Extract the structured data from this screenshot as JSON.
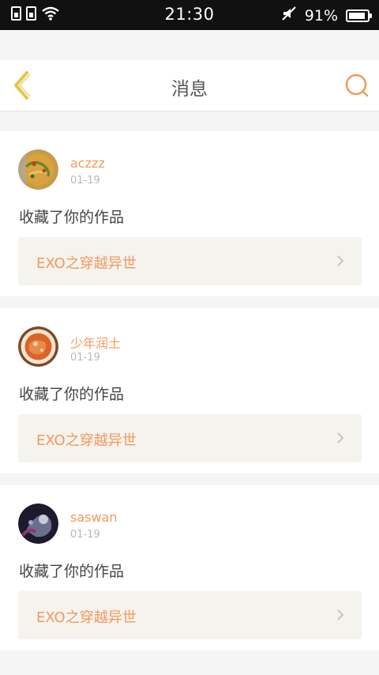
{
  "status_bar": {
    "time": "21:30",
    "battery_text": "91%",
    "battery_level": 0.91,
    "icons": [
      "sim-card-icon",
      "sim-card-icon",
      "wifi-icon",
      "mute-icon",
      "battery-icon"
    ]
  },
  "header": {
    "title": "消息",
    "back_icon": "chevron-left-icon",
    "search_icon": "search-icon"
  },
  "colors": {
    "accent": "#f2995c",
    "back_icon": "#e7c54c",
    "card_link_bg": "#f4f3ee",
    "page_bg": "#f5f5f5"
  },
  "messages": [
    {
      "username": "aczzz",
      "date": "01-19",
      "action": "收藏了你的作品",
      "work_title": "EXO之穿越异世",
      "avatar_theme": "food"
    },
    {
      "username": "少年润土",
      "date": "01-19",
      "action": "收藏了你的作品",
      "work_title": "EXO之穿越异世",
      "avatar_theme": "orange-plate"
    },
    {
      "username": "saswan",
      "date": "01-19",
      "action": "收藏了你的作品",
      "work_title": "EXO之穿越异世",
      "avatar_theme": "dark-photo"
    }
  ]
}
